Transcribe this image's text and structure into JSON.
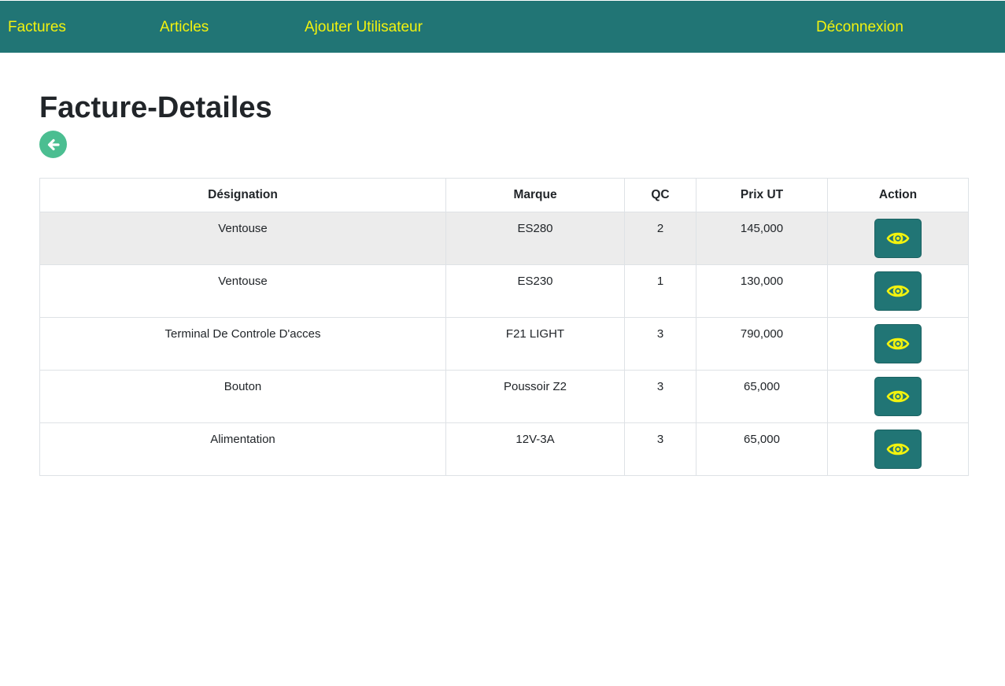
{
  "nav": {
    "items": [
      {
        "label": "Factures"
      },
      {
        "label": "Articles"
      },
      {
        "label": "Ajouter Utilisateur"
      }
    ],
    "logout_label": "Déconnexion"
  },
  "page": {
    "title": "Facture-Detailes",
    "back_icon": "arrow-left-icon"
  },
  "table": {
    "headers": [
      "Désignation",
      "Marque",
      "QC",
      "Prix UT",
      "Action"
    ],
    "rows": [
      {
        "designation": "Ventouse",
        "marque": "ES280",
        "qc": "2",
        "prix": "145,000"
      },
      {
        "designation": "Ventouse",
        "marque": "ES230",
        "qc": "1",
        "prix": "130,000"
      },
      {
        "designation": "Terminal De Controle D'acces",
        "marque": "F21 LIGHT",
        "qc": "3",
        "prix": "790,000"
      },
      {
        "designation": "Bouton",
        "marque": "Poussoir Z2",
        "qc": "3",
        "prix": "65,000"
      },
      {
        "designation": "Alimentation",
        "marque": "12V-3A",
        "qc": "3",
        "prix": "65,000"
      }
    ],
    "action_icon": "eye-icon"
  },
  "colors": {
    "navbar": "#217575",
    "nav_text": "#f2f20f",
    "back_button": "#4bbe91",
    "action_button": "#217575",
    "eye_icon": "#f2f20f",
    "highlight_row": "#ececec"
  }
}
